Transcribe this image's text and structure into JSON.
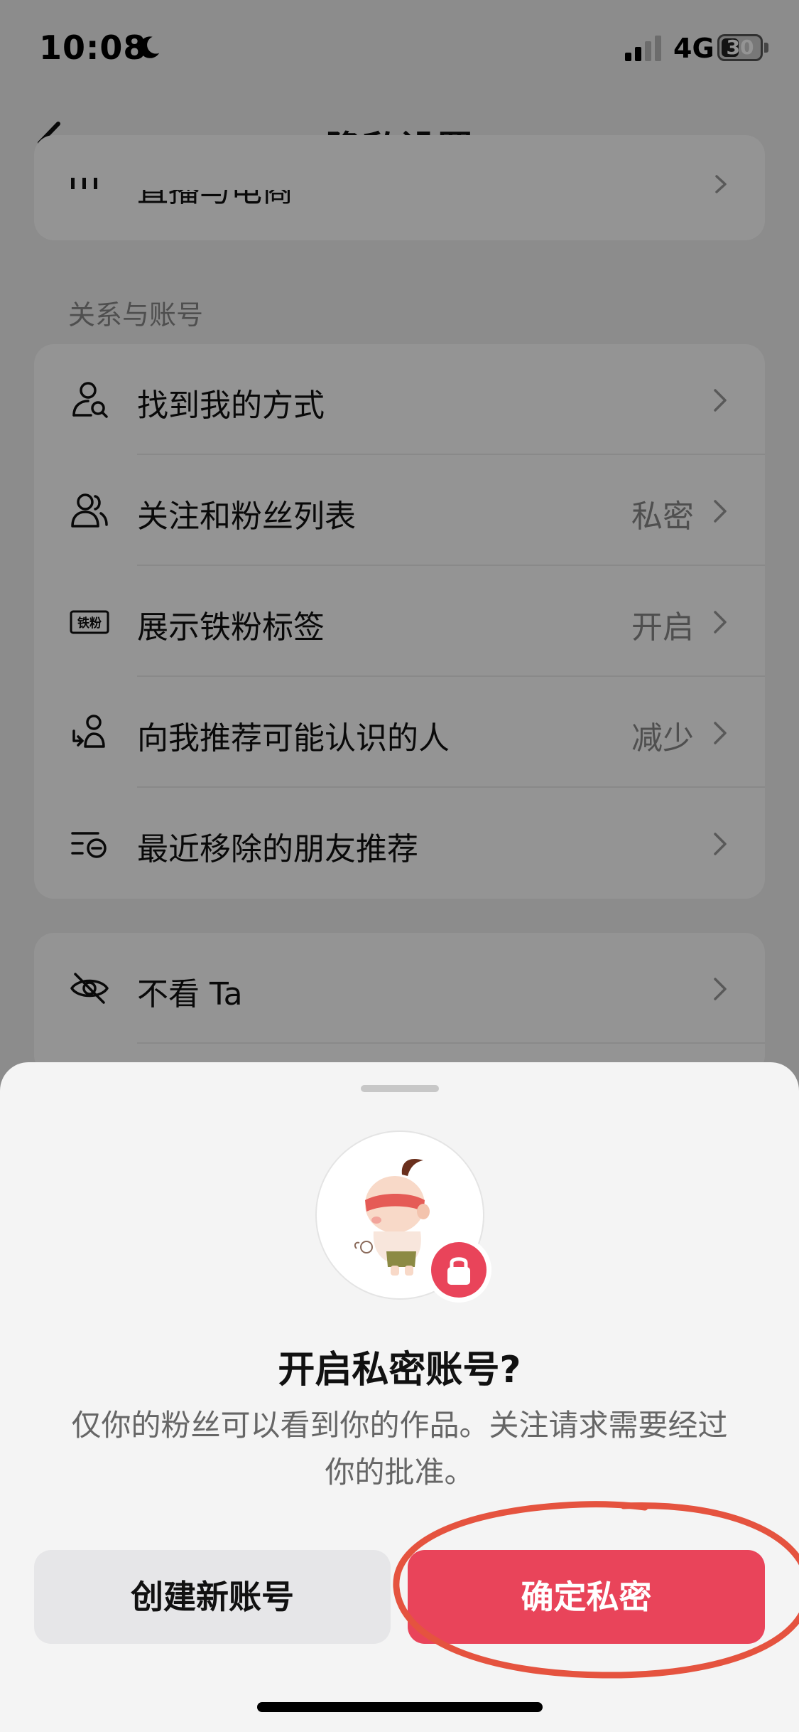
{
  "status_bar": {
    "time": "10:08",
    "network": "4G",
    "battery": "30",
    "icons": [
      "moon-icon",
      "signal-icon",
      "battery-icon"
    ]
  },
  "nav": {
    "title": "隐私设置",
    "back_icon": "chevron-left-icon"
  },
  "top_card": {
    "partial_label": "直播与电商",
    "icon": "live-commerce-icon"
  },
  "relations_section": {
    "label": "关系与账号",
    "items": [
      {
        "label": "找到我的方式",
        "value": "",
        "icon": "person-search-icon"
      },
      {
        "label": "关注和粉丝列表",
        "value": "私密",
        "icon": "people-icon"
      },
      {
        "label": "展示铁粉标签",
        "value": "开启",
        "icon": "iron-fan-badge-icon",
        "icon_text": "铁粉"
      },
      {
        "label": "向我推荐可能认识的人",
        "value": "减少",
        "icon": "recommend-person-icon"
      },
      {
        "label": "最近移除的朋友推荐",
        "value": "",
        "icon": "removed-list-icon"
      }
    ]
  },
  "block_card": {
    "items": [
      {
        "label": "不看 Ta",
        "icon": "eye-off-icon"
      }
    ]
  },
  "sheet": {
    "title": "开启私密账号?",
    "description": "仅你的粉丝可以看到你的作品。关注请求需要经过你的批准。",
    "secondary_button": "创建新账号",
    "primary_button": "确定私密",
    "accent_color": "#e9445a",
    "annotation_color": "#e5533f"
  }
}
